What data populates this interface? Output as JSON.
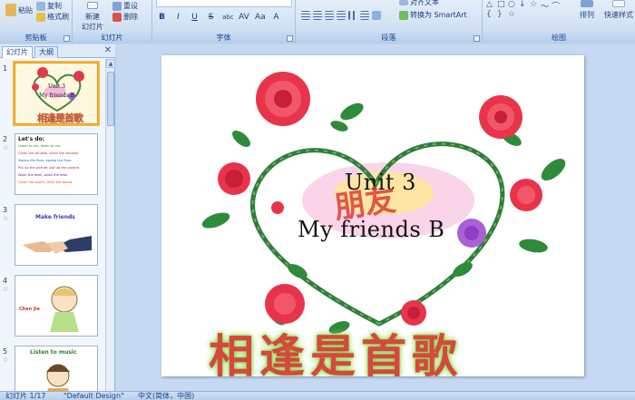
{
  "ribbon": {
    "clipboard": {
      "paste": "粘贴",
      "copy": "复制",
      "format_painter": "格式刷",
      "group_label": "剪贴板"
    },
    "slides": {
      "new_slide_line1": "新建",
      "new_slide_line2": "幻灯片",
      "reset": "重设",
      "delete": "删除",
      "group_label": "幻灯片"
    },
    "font": {
      "group_label": "字体",
      "buttons": [
        "B",
        "I",
        "U",
        "S",
        "abc",
        "AV",
        "Aa",
        "A"
      ]
    },
    "paragraph": {
      "align_text": "对齐文本",
      "convert_smartart": "转换为 SmartArt",
      "group_label": "段落"
    },
    "drawing": {
      "arrange": "排列",
      "quick_styles": "快速样式",
      "group_label": "绘图",
      "shapes": [
        "△",
        "□",
        "○",
        "↓",
        "☆",
        "〜",
        "⌒",
        "{",
        "}",
        "☆"
      ]
    }
  },
  "left_panel": {
    "tabs": [
      "幻灯片",
      "大纲"
    ],
    "close": "✕",
    "thumbnails": [
      {
        "number": "1",
        "title_line1": "Unit 3",
        "title_line2": "My friends B",
        "banner": "相逢是首歌"
      },
      {
        "number": "2",
        "heading": "Let's do:",
        "lines": [
          "Listen to me, listen to me.",
          "Clean the window, clean the window.",
          "Sweep the floor, sweep the floor.",
          "Put up the picture, put up the picture.",
          "Wash the desk, wash the desk.",
          "Clean the board, clean the board."
        ]
      },
      {
        "number": "3",
        "heading": "Make friends"
      },
      {
        "number": "4",
        "label": "Chen Jie"
      },
      {
        "number": "5",
        "heading": "Listen to music"
      }
    ],
    "star": "☆"
  },
  "slide": {
    "title_line1": "Unit 3",
    "title_line2": "My friends B",
    "chinese_title": "朋友",
    "banner": "相逢是首歌"
  },
  "statusbar": {
    "slide_counter": "幻灯片 1/17",
    "theme": "\"Default Design\"",
    "language": "中文(简体，中国)"
  }
}
